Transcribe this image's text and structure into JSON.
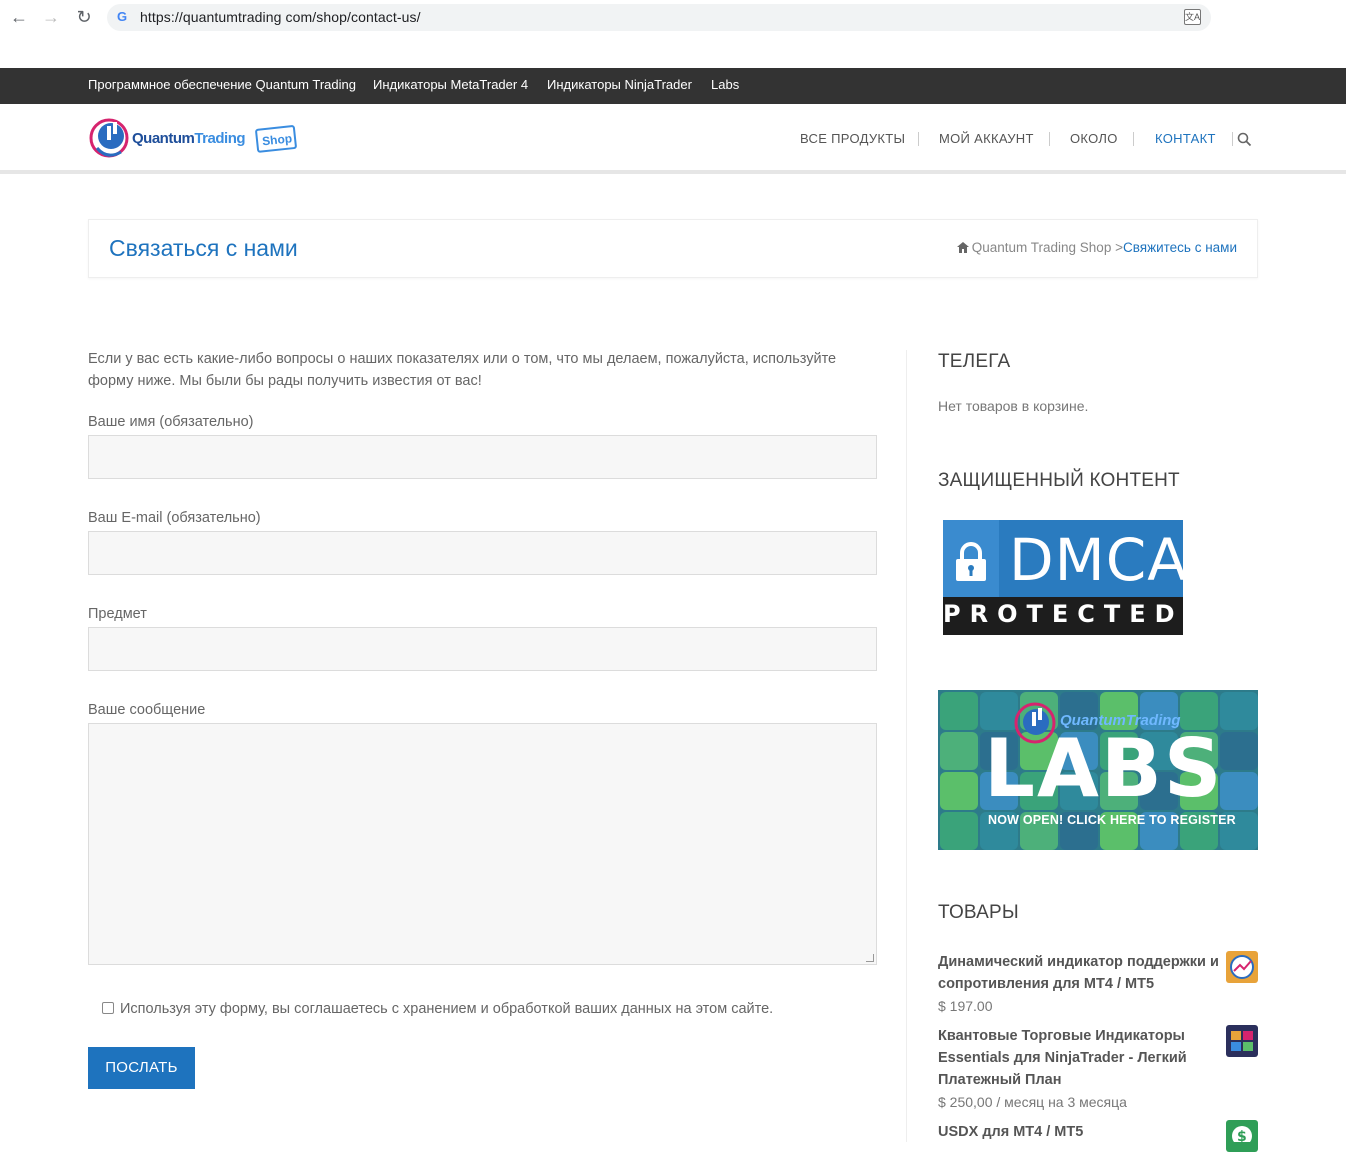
{
  "browser": {
    "url": "https://quantumtrading com/shop/contact-us/"
  },
  "topbar": {
    "links": [
      "Программное обеспечение Quantum Trading",
      "Индикаторы MetaTrader 4",
      "Индикаторы NinjaTrader",
      "Labs"
    ]
  },
  "header": {
    "logo_text": "QuantumTrading",
    "logo_badge": "Shop",
    "nav": [
      "ВСЕ ПРОДУКТЫ",
      "МОЙ АККАУНТ",
      "ОКОЛО",
      "КОНТАКТ"
    ],
    "active_nav": "КОНТАКТ"
  },
  "page": {
    "title": "Связаться с нами",
    "breadcrumb_home": "Quantum Trading Shop",
    "breadcrumb_sep": ">",
    "breadcrumb_current": "Свяжитесь с нами"
  },
  "form": {
    "intro": "Если у вас есть какие-либо вопросы о наших показателях или о том, что мы делаем, пожалуйста, используйте форму ниже. Мы были бы рады получить известия от вас!",
    "name_label": "Ваше имя (обязательно)",
    "email_label": "Ваш E-mail (обязательно)",
    "subject_label": "Предмет",
    "message_label": "Ваше сообщение",
    "name_value": "",
    "email_value": "",
    "subject_value": "",
    "message_value": "",
    "consent_text": "Используя эту форму, вы соглашаетесь с хранением и обработкой ваших данных на этом сайте.",
    "consent_checked": false,
    "submit_label": "ПОСЛАТЬ"
  },
  "sidebar": {
    "cart_title": "ТЕЛЕГА",
    "cart_empty": "Нет товаров в корзине.",
    "protected_title": "ЗАЩИЩЕННЫЙ КОНТЕНТ",
    "dmca_top": "DMCA",
    "dmca_bottom": "PROTECTED",
    "labs_brand": "QuantumTrading",
    "labs_big": "LABS",
    "labs_cta": "NOW OPEN! CLICK HERE TO REGISTER",
    "products_title": "ТОВАРЫ",
    "products": [
      {
        "name": "Динамический индикатор поддержки и сопротивления для MT4 / MT5",
        "price": "$ 197.00"
      },
      {
        "name": "Квантовые Торговые Индикаторы Essentials для NinjaTrader - Легкий Платежный План",
        "price": "$ 250,00 / месяц на 3 месяца"
      },
      {
        "name": "USDX для MT4 / MT5",
        "price": ""
      }
    ]
  },
  "colors": {
    "accent": "#1e73be",
    "topbar_bg": "#333333"
  }
}
